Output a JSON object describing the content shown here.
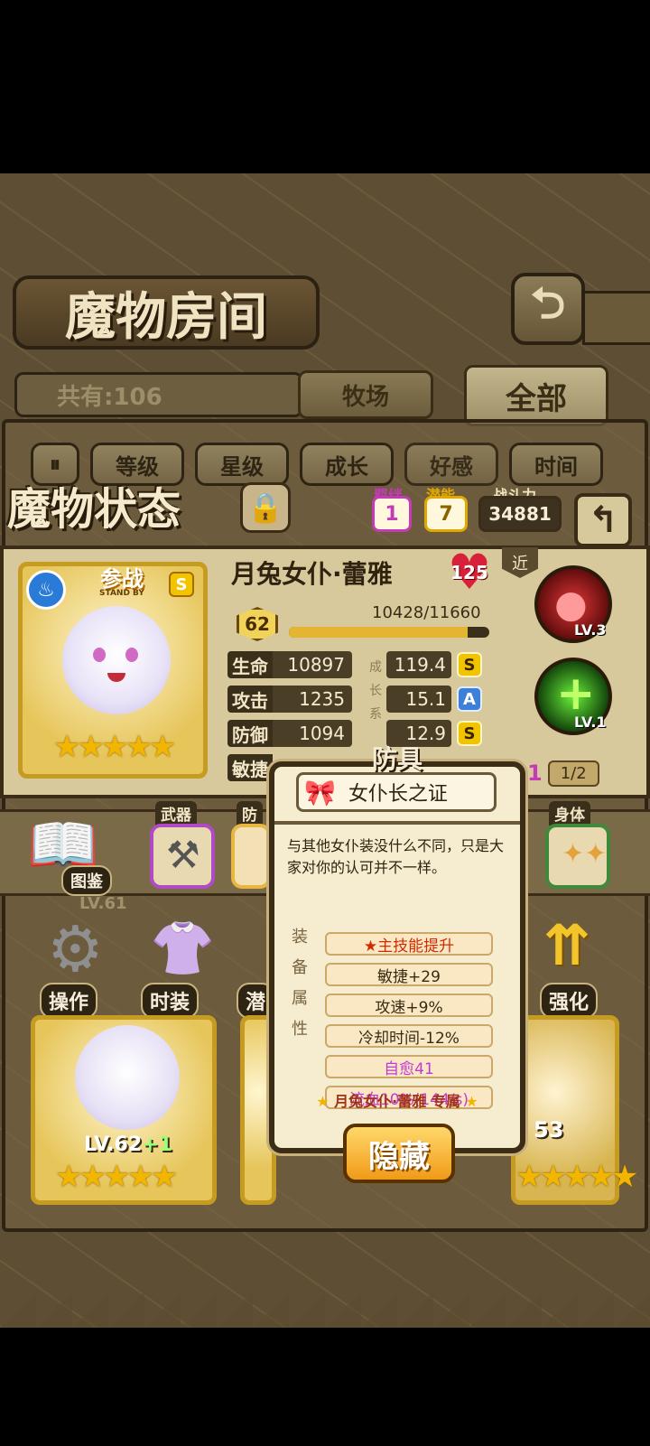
{
  "room": {
    "title": "魔物房间",
    "owned": "共有:106",
    "tab_ranch": "牧场",
    "tab_all": "全部",
    "filters": [
      "等级",
      "星级",
      "成长",
      "好感",
      "时间"
    ]
  },
  "status": {
    "title": "魔物状态",
    "bond_label": "羁绊",
    "bond_value": "1",
    "potential_label": "潜能",
    "potential_value": "7",
    "power_label": "战斗力",
    "power_value": "34881",
    "range_tag": "近",
    "name": "月兔女仆·蕾雅",
    "affection": "125",
    "level": "62",
    "exp": "10428/11660",
    "exp_fraction": 0.894,
    "growth_chars": [
      "成",
      "长",
      "系"
    ],
    "stats": [
      {
        "name": "生命",
        "value": "10897",
        "growth": "119.4",
        "grade": "S"
      },
      {
        "name": "攻击",
        "value": "1235",
        "growth": "15.1",
        "grade": "A"
      },
      {
        "name": "防御",
        "value": "1094",
        "growth": "12.9",
        "grade": "S"
      },
      {
        "name": "敏捷"
      }
    ],
    "card_standby": "参战",
    "card_standby_en": "STAND BY",
    "card_grade": "S",
    "stars": "★★★★★",
    "skill1_level": "LV.3",
    "skill2_level": "LV.1",
    "awaken_value": "1",
    "awaken_progress": "1/2"
  },
  "equip_labels": {
    "weapon": "武器",
    "armor": "防",
    "body": "身体",
    "guide": "图鉴"
  },
  "menu": {
    "operate": "操作",
    "fashion": "时装",
    "potential": "潜",
    "enhance": "强化"
  },
  "bottom_cards": {
    "card1_level": "LV.62",
    "card1_plus": "+1",
    "card3_level": "53",
    "card_top_level": "LV.61"
  },
  "popup": {
    "category": "防具",
    "item_name": "女仆长之证",
    "description": "与其他女仆装没什么不同，只是大家对你的认可并不一样。",
    "side_label": [
      "装",
      "备",
      "属",
      "性"
    ],
    "attrs": [
      {
        "text": "★主技能提升",
        "color": "#d42a00"
      },
      {
        "text": "敏捷+29",
        "color": "#3a2a12"
      },
      {
        "text": "攻速+9%",
        "color": "#3a2a12"
      },
      {
        "text": "冷却时间-12%",
        "color": "#3a2a12"
      },
      {
        "text": "自愈41",
        "color": "#c23ad6"
      },
      {
        "text": "流血10%(144/s)",
        "color": "#c23ad6"
      }
    ],
    "exclusive": "月兔女仆·蕾雅 专属",
    "hide_button": "隐藏"
  },
  "colors": {
    "exp_bar": "#e3b530",
    "grade_s": "#f2c400",
    "grade_a": "#3e7fd8",
    "affection": "#d8203a",
    "popup_bg": "#f6ecd0"
  }
}
